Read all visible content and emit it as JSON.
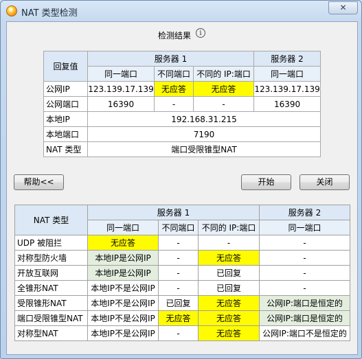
{
  "window": {
    "title": "NAT 类型检测",
    "close_glyph": "✕",
    "app_icon": "app-icon-orange-circle"
  },
  "result": {
    "title": "检测结果",
    "info_glyph": "i",
    "headers": {
      "reply": "回复值",
      "server1": "服务器 1",
      "server2": "服务器 2",
      "same_port": "同一端口",
      "diff_port": "不同端口",
      "diff_ip_port": "不同的 IP:端口",
      "same_port2": "同一端口"
    },
    "rows": [
      {
        "label": "公网IP",
        "c1": "123.139.17.139",
        "c2": "无应答",
        "c3": "无应答",
        "c4": "123.139.17.139"
      },
      {
        "label": "公网端口",
        "c1": "16390",
        "c2": "-",
        "c3": "-",
        "c4": "16390"
      }
    ],
    "local_ip": {
      "label": "本地IP",
      "value": "192.168.31.215"
    },
    "local_port": {
      "label": "本地端口",
      "value": "7190"
    },
    "nat_type": {
      "label": "NAT 类型",
      "value": "端口受限锥型NAT"
    }
  },
  "buttons": {
    "help": "帮助<<",
    "start": "开始",
    "close": "关闭"
  },
  "reference": {
    "headers": {
      "nat_type": "NAT 类型",
      "server1": "服务器 1",
      "server2": "服务器 2",
      "same_port": "同一端口",
      "diff_port": "不同端口",
      "diff_ip_port": "不同的 IP:端口",
      "same_port2": "同一端口"
    },
    "rows": [
      {
        "label": "UDP 被阻拦",
        "c1": "无应答",
        "c2": "-",
        "c3": "-",
        "c4": "-"
      },
      {
        "label": "对称型防火墙",
        "c1": "本地IP是公网IP",
        "c2": "-",
        "c3": "无应答",
        "c4": "-"
      },
      {
        "label": "开放互联网",
        "c1": "本地IP是公网IP",
        "c2": "-",
        "c3": "已回复",
        "c4": "-"
      },
      {
        "label": "全锥形NAT",
        "c1": "本地IP不是公网IP",
        "c2": "-",
        "c3": "已回复",
        "c4": "-"
      },
      {
        "label": "受限锥形NAT",
        "c1": "本地IP不是公网IP",
        "c2": "已回复",
        "c3": "无应答",
        "c4": "公网IP:端口是恒定的"
      },
      {
        "label": "端口受限锥型NAT",
        "c1": "本地IP不是公网IP",
        "c2": "无应答",
        "c3": "无应答",
        "c4": "公网IP:端口是恒定的"
      },
      {
        "label": "对称型NAT",
        "c1": "本地IP不是公网IP",
        "c2": "-",
        "c3": "无应答",
        "c4": "公网IP:端口不是恒定的"
      }
    ]
  },
  "colors": {
    "highlight_yellow": "#fffb00",
    "highlight_green": "#e4eedf",
    "header_blue": "#dce8f5"
  }
}
